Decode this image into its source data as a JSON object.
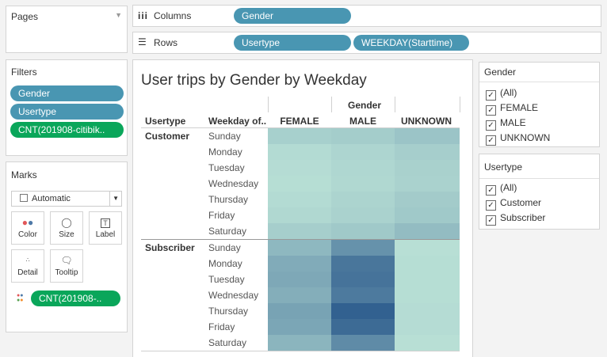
{
  "pages": {
    "title": "Pages"
  },
  "columns_shelf": {
    "label": "Columns",
    "pills": [
      "Gender"
    ]
  },
  "rows_shelf": {
    "label": "Rows",
    "pills": [
      "Usertype",
      "WEEKDAY(Starttime)"
    ]
  },
  "filters": {
    "title": "Filters",
    "pills": [
      "Gender",
      "Usertype",
      "CNT(201908-citibik.."
    ]
  },
  "marks": {
    "title": "Marks",
    "type": "Automatic",
    "buttons": [
      "Color",
      "Size",
      "Label",
      "Detail",
      "Tooltip"
    ],
    "color_pill": "CNT(201908-.."
  },
  "viz": {
    "title": "User trips by Gender by Weekday",
    "gender_header": "Gender",
    "usertype_header": "Usertype",
    "weekday_header": "Weekday of..",
    "genders": [
      "FEMALE",
      "MALE",
      "UNKNOWN"
    ],
    "groups": [
      "Customer",
      "Subscriber"
    ],
    "weekdays": [
      "Sunday",
      "Monday",
      "Tuesday",
      "Wednesday",
      "Thursday",
      "Friday",
      "Saturday"
    ]
  },
  "legend_gender": {
    "title": "Gender",
    "items": [
      "(All)",
      "FEMALE",
      "MALE",
      "UNKNOWN"
    ]
  },
  "legend_usertype": {
    "title": "Usertype",
    "items": [
      "(All)",
      "Customer",
      "Subscriber"
    ]
  },
  "chart_data": {
    "type": "heatmap",
    "title": "User trips by Gender by Weekday",
    "columns": [
      "FEMALE",
      "MALE",
      "UNKNOWN"
    ],
    "rows": [
      {
        "usertype": "Customer",
        "weekday": "Sunday",
        "values": [
          0.16,
          0.18,
          0.24
        ]
      },
      {
        "usertype": "Customer",
        "weekday": "Monday",
        "values": [
          0.08,
          0.12,
          0.17
        ]
      },
      {
        "usertype": "Customer",
        "weekday": "Tuesday",
        "values": [
          0.07,
          0.11,
          0.15
        ]
      },
      {
        "usertype": "Customer",
        "weekday": "Wednesday",
        "values": [
          0.06,
          0.1,
          0.14
        ]
      },
      {
        "usertype": "Customer",
        "weekday": "Thursday",
        "values": [
          0.08,
          0.13,
          0.19
        ]
      },
      {
        "usertype": "Customer",
        "weekday": "Friday",
        "values": [
          0.1,
          0.14,
          0.21
        ]
      },
      {
        "usertype": "Customer",
        "weekday": "Saturday",
        "values": [
          0.17,
          0.21,
          0.3
        ]
      },
      {
        "usertype": "Subscriber",
        "weekday": "Sunday",
        "values": [
          0.33,
          0.6,
          0.05
        ]
      },
      {
        "usertype": "Subscriber",
        "weekday": "Monday",
        "values": [
          0.42,
          0.8,
          0.06
        ]
      },
      {
        "usertype": "Subscriber",
        "weekday": "Tuesday",
        "values": [
          0.44,
          0.82,
          0.06
        ]
      },
      {
        "usertype": "Subscriber",
        "weekday": "Wednesday",
        "values": [
          0.4,
          0.77,
          0.06
        ]
      },
      {
        "usertype": "Subscriber",
        "weekday": "Thursday",
        "values": [
          0.48,
          0.95,
          0.07
        ]
      },
      {
        "usertype": "Subscriber",
        "weekday": "Friday",
        "values": [
          0.46,
          0.88,
          0.07
        ]
      },
      {
        "usertype": "Subscriber",
        "weekday": "Saturday",
        "values": [
          0.35,
          0.65,
          0.05
        ]
      }
    ],
    "color_range": [
      "#bfe6d9",
      "#2b5a8c"
    ]
  }
}
